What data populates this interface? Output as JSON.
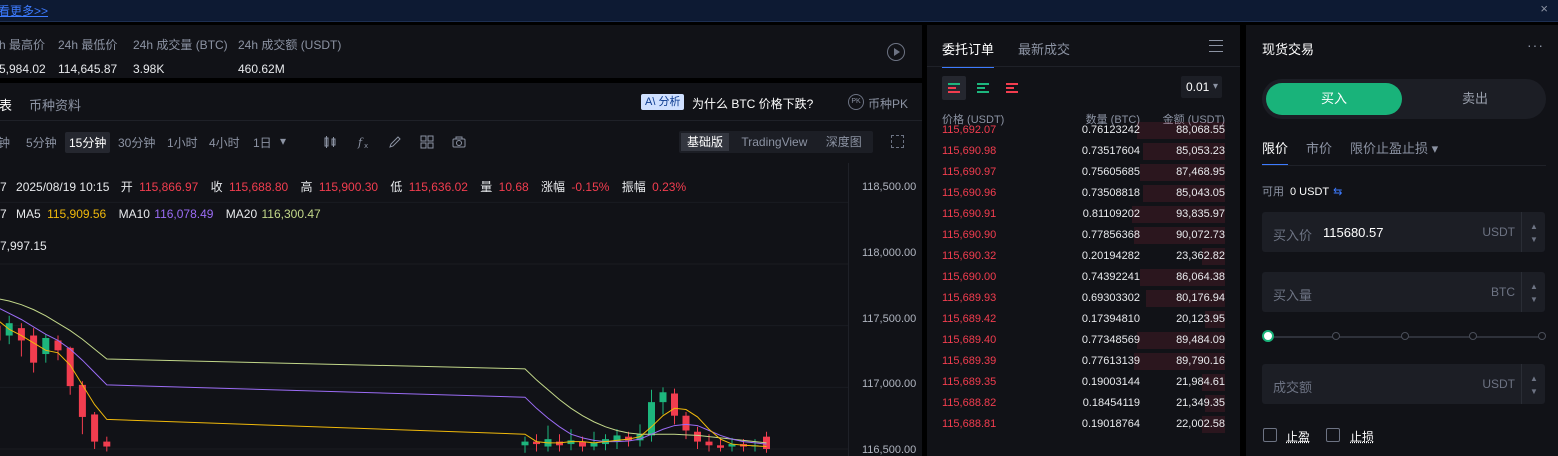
{
  "banner": {
    "link": "看更多>>",
    "close": "×"
  },
  "stats": [
    {
      "label": "h 最高价",
      "value": "5,984.02"
    },
    {
      "label": "24h 最低价",
      "value": "114,645.87"
    },
    {
      "label": "24h 成交量 (BTC)",
      "value": "3.98K"
    },
    {
      "label": "24h 成交额 (USDT)",
      "value": "460.62M"
    }
  ],
  "chart_tabs": {
    "chart": "表",
    "info": "币种资料"
  },
  "analysis": {
    "badge": "A\\ 分析",
    "question": "为什么 BTC 价格下跌?",
    "pk_icon": "PK",
    "pk_label": "币种PK"
  },
  "intervals": [
    "钟",
    "5分钟",
    "15分钟",
    "30分钟",
    "1小时",
    "4小时",
    "1日"
  ],
  "active_interval": "15分钟",
  "day_dropdown_icon": "▾",
  "tools": [
    "candles-icon",
    "indicator-icon",
    "pencil-icon",
    "layout-icon",
    "camera-icon"
  ],
  "views": [
    "基础版",
    "TradingView",
    "深度图"
  ],
  "active_view": "基础版",
  "ohlc": {
    "prefix": "7",
    "date": "2025/08/19 10:15",
    "open_label": "开",
    "open": "115,866.97",
    "close_label": "收",
    "close": "115,688.80",
    "high_label": "高",
    "high": "115,900.30",
    "low_label": "低",
    "low": "115,636.02",
    "vol_label": "量",
    "vol": "10.68",
    "chg_label": "涨幅",
    "chg": "-0.15%",
    "amp_label": "振幅",
    "amp": "0.23%"
  },
  "ma": {
    "prefix": "7",
    "ma5_label": "MA5",
    "ma5": "115,909.56",
    "ma10_label": "MA10",
    "ma10": "116,078.49",
    "ma20_label": "MA20",
    "ma20": "116,300.47"
  },
  "high_marker": "7,997.15",
  "colors": {
    "up": "#1db67d",
    "down": "#f23d4f",
    "ma5": "#f0b90b",
    "ma10": "#9b6cf5",
    "ma20": "#c3d88a",
    "accent": "#3d7bff",
    "buy": "#19b37a"
  },
  "chart_data": {
    "type": "candlestick",
    "y_ticks": [
      "118,500.00",
      "118,000.00",
      "117,500.00",
      "117,000.00",
      "116,500.00"
    ],
    "ylim": [
      116500,
      118600
    ],
    "candles": [
      {
        "o": 117500,
        "c": 117380,
        "h": 117560,
        "l": 117300
      },
      {
        "o": 117420,
        "c": 117520,
        "h": 117580,
        "l": 117350
      },
      {
        "o": 117480,
        "c": 117380,
        "h": 117520,
        "l": 117250
      },
      {
        "o": 117420,
        "c": 117200,
        "h": 117480,
        "l": 117120
      },
      {
        "o": 117270,
        "c": 117400,
        "h": 117430,
        "l": 117200
      },
      {
        "o": 117380,
        "c": 117300,
        "h": 117420,
        "l": 117220
      },
      {
        "o": 117320,
        "c": 117010,
        "h": 117330,
        "l": 116940
      },
      {
        "o": 117020,
        "c": 116760,
        "h": 117050,
        "l": 116620
      },
      {
        "o": 116780,
        "c": 116560,
        "h": 116800,
        "l": 116500
      },
      {
        "o": 116560,
        "c": 116520,
        "h": 116600,
        "l": 116480
      },
      {
        "o": 116530,
        "c": 116560,
        "h": 116600,
        "l": 116470
      },
      {
        "o": 116560,
        "c": 116540,
        "h": 116620,
        "l": 116480
      },
      {
        "o": 116520,
        "c": 116580,
        "h": 116690,
        "l": 116480
      },
      {
        "o": 116560,
        "c": 116530,
        "h": 116620,
        "l": 116480
      },
      {
        "o": 116540,
        "c": 116570,
        "h": 116660,
        "l": 116490
      },
      {
        "o": 116560,
        "c": 116520,
        "h": 116600,
        "l": 116480
      },
      {
        "o": 116520,
        "c": 116550,
        "h": 116640,
        "l": 116490
      },
      {
        "o": 116540,
        "c": 116580,
        "h": 116620,
        "l": 116490
      },
      {
        "o": 116560,
        "c": 116610,
        "h": 116660,
        "l": 116500
      },
      {
        "o": 116600,
        "c": 116570,
        "h": 116640,
        "l": 116520
      },
      {
        "o": 116570,
        "c": 116620,
        "h": 116700,
        "l": 116520
      },
      {
        "o": 116610,
        "c": 116880,
        "h": 116980,
        "l": 116560
      },
      {
        "o": 116880,
        "c": 116960,
        "h": 117000,
        "l": 116780
      },
      {
        "o": 116950,
        "c": 116770,
        "h": 116990,
        "l": 116700
      },
      {
        "o": 116770,
        "c": 116650,
        "h": 116800,
        "l": 116580
      },
      {
        "o": 116640,
        "c": 116560,
        "h": 116680,
        "l": 116500
      },
      {
        "o": 116560,
        "c": 116530,
        "h": 116620,
        "l": 116480
      },
      {
        "o": 116530,
        "c": 116510,
        "h": 116590,
        "l": 116480
      },
      {
        "o": 116520,
        "c": 116540,
        "h": 116590,
        "l": 116480
      },
      {
        "o": 116540,
        "c": 116520,
        "h": 116580,
        "l": 116480
      },
      {
        "o": 116520,
        "c": 116530,
        "h": 116580,
        "l": 116480
      },
      {
        "o": 116600,
        "c": 116500,
        "h": 116640,
        "l": 116470
      }
    ],
    "ma5": [
      117550,
      117470,
      117420,
      117360,
      117300,
      117280,
      117180,
      117020,
      116860,
      116740,
      116620,
      116560,
      116550,
      116550,
      116560,
      116560,
      116550,
      116560,
      116570,
      116580,
      116600,
      116680,
      116770,
      116830,
      116820,
      116760,
      116660,
      116580,
      116540,
      116530,
      116525,
      116520
    ],
    "ma10": [
      117650,
      117600,
      117550,
      117490,
      117430,
      117380,
      117310,
      117220,
      117120,
      117020,
      116920,
      116830,
      116750,
      116680,
      116620,
      116590,
      116570,
      116560,
      116560,
      116565,
      116580,
      116620,
      116660,
      116690,
      116700,
      116690,
      116650,
      116610,
      116580,
      116560,
      116550,
      116540
    ],
    "ma20": [
      117720,
      117700,
      117670,
      117630,
      117580,
      117520,
      117460,
      117390,
      117310,
      117230,
      117150,
      117060,
      116980,
      116900,
      116830,
      116770,
      116720,
      116680,
      116650,
      116630,
      116620,
      116620,
      116620,
      116620,
      116615,
      116610,
      116600,
      116590,
      116580,
      116570,
      116560,
      116550
    ]
  },
  "orderbook": {
    "tabs": [
      "委托订单",
      "最新成交"
    ],
    "precision": "0.01",
    "headers": {
      "price": "价格 (USDT)",
      "qty": "数量 (BTC)",
      "amount": "金额 (USDT)"
    },
    "asks": [
      {
        "price": "115,692.07",
        "qty": "0.76123242",
        "amount": "88,068.55",
        "depth": 0.31
      },
      {
        "price": "115,690.98",
        "qty": "0.73517604",
        "amount": "85,053.23",
        "depth": 0.29
      },
      {
        "price": "115,690.97",
        "qty": "0.75605685",
        "amount": "87,468.95",
        "depth": 0.3
      },
      {
        "price": "115,690.96",
        "qty": "0.73508818",
        "amount": "85,043.05",
        "depth": 0.29
      },
      {
        "price": "115,690.91",
        "qty": "0.81109202",
        "amount": "93,835.97",
        "depth": 0.33
      },
      {
        "price": "115,690.90",
        "qty": "0.77856368",
        "amount": "90,072.73",
        "depth": 0.32
      },
      {
        "price": "115,690.32",
        "qty": "0.20194282",
        "amount": "23,362.82",
        "depth": 0.08
      },
      {
        "price": "115,690.00",
        "qty": "0.74392241",
        "amount": "86,064.38",
        "depth": 0.3
      },
      {
        "price": "115,689.93",
        "qty": "0.69303302",
        "amount": "80,176.94",
        "depth": 0.28
      },
      {
        "price": "115,689.42",
        "qty": "0.17394810",
        "amount": "20,123.95",
        "depth": 0.07
      },
      {
        "price": "115,689.40",
        "qty": "0.77348569",
        "amount": "89,484.09",
        "depth": 0.31
      },
      {
        "price": "115,689.39",
        "qty": "0.77613139",
        "amount": "89,790.16",
        "depth": 0.32
      },
      {
        "price": "115,689.35",
        "qty": "0.19003144",
        "amount": "21,984.61",
        "depth": 0.08
      },
      {
        "price": "115,688.82",
        "qty": "0.18454119",
        "amount": "21,349.35",
        "depth": 0.07
      },
      {
        "price": "115,688.81",
        "qty": "0.19018764",
        "amount": "22,002.58",
        "depth": 0.08
      }
    ]
  },
  "trade": {
    "title": "现货交易",
    "more": "···",
    "buy": "买入",
    "sell": "卖出",
    "order_tabs": [
      "限价",
      "市价",
      "限价止盈止损 ▾"
    ],
    "available_label": "可用",
    "available_value": "0 USDT",
    "swap_icon": "⇆",
    "price_label": "买入价",
    "price_value": "115680.57",
    "price_unit": "USDT",
    "qty_label": "买入量",
    "qty_unit": "BTC",
    "amount_label": "成交额",
    "amount_unit": "USDT",
    "tp_label": "止盈",
    "sl_label": "止损"
  }
}
